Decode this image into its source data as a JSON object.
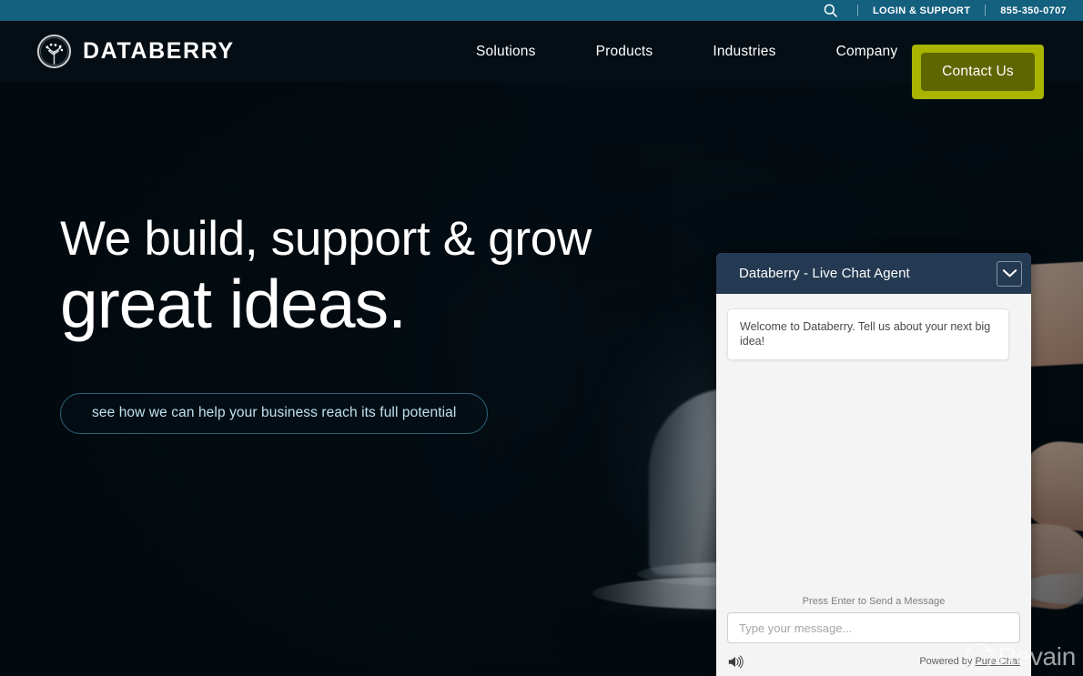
{
  "topbar": {
    "search_icon": "search-icon",
    "login_label": "LOGIN & SUPPORT",
    "phone": "855-350-0707"
  },
  "brand": {
    "name": "DATABERRY",
    "logo_icon": "berry-tree-logo-icon"
  },
  "nav": {
    "items": [
      {
        "label": "Solutions"
      },
      {
        "label": "Products"
      },
      {
        "label": "Industries"
      },
      {
        "label": "Company"
      }
    ],
    "cta_label": "Contact Us"
  },
  "hero": {
    "headline_line1": "We build, support & grow",
    "headline_line2": "great ideas.",
    "cta_label": "see how we can help your business reach its full potential"
  },
  "chat": {
    "title": "Databerry - Live Chat Agent",
    "minimize_icon": "chevron-down-icon",
    "messages": [
      {
        "text": "Welcome to Databerry. Tell us about your next big idea!"
      }
    ],
    "send_hint": "Press Enter to Send a Message",
    "input_placeholder": "Type your message...",
    "input_value": "",
    "sound_icon": "speaker-icon",
    "powered_prefix": "Powered by ",
    "powered_brand": "Pure Chat"
  },
  "watermark": {
    "text": "Revain"
  },
  "colors": {
    "topbar_teal": "#14607f",
    "nav_dark": "#050e14",
    "cta_frame_green": "#a8b400",
    "cta_inner_olive": "#5d6600",
    "hero_bg": "#030c12",
    "hero_cta_text": "#bfe2f0",
    "chat_header": "#243a52",
    "chat_body": "#f4f4f4"
  }
}
